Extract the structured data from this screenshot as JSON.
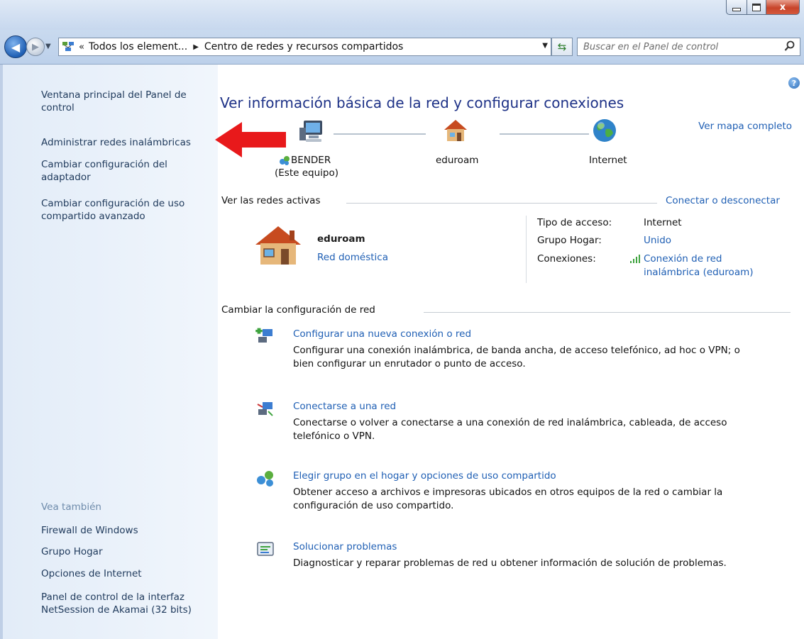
{
  "titlebar": {
    "minimize_icon": "minimize-icon",
    "maximize_icon": "maximize-icon",
    "close_icon": "close-icon",
    "close_glyph": "x"
  },
  "navbar": {
    "back_glyph": "◀",
    "forward_glyph": "▶",
    "breadcrumb": [
      "Todos los element...",
      "Centro de redes y recursos compartidos"
    ],
    "chevron_glyph": "«",
    "separator_glyph": "▶",
    "search_placeholder": "Buscar en el Panel de control"
  },
  "sidebar": {
    "items": [
      {
        "label": "Ventana principal del Panel de control"
      },
      {
        "label": "Administrar redes inalámbricas"
      },
      {
        "label": "Cambiar configuración del adaptador"
      },
      {
        "label": "Cambiar configuración de uso compartido avanzado"
      }
    ],
    "see_also_caption": "Vea también",
    "see_also": [
      {
        "label": "Firewall de Windows"
      },
      {
        "label": "Grupo Hogar"
      },
      {
        "label": "Opciones de Internet"
      },
      {
        "label": "Panel de control de la interfaz NetSession de Akamai (32 bits)"
      }
    ]
  },
  "main": {
    "help_glyph": "?",
    "title": "Ver información básica de la red y configurar conexiones",
    "full_map_link": "Ver mapa completo",
    "network_map": {
      "computer_name": "BENDER",
      "computer_sub": "(Este equipo)",
      "network_name": "eduroam",
      "internet": "Internet"
    },
    "active_networks": {
      "heading": "Ver las redes activas",
      "connect_link": "Conectar o desconectar",
      "network_name": "eduroam",
      "network_type": "Red doméstica",
      "access_type_label": "Tipo de acceso:",
      "access_type_value": "Internet",
      "homegroup_label": "Grupo Hogar:",
      "homegroup_value": "Unido",
      "connections_label": "Conexiones:",
      "connections_value_line1": "Conexión de red",
      "connections_value_line2": "inalámbrica (eduroam)"
    },
    "change_settings": {
      "heading": "Cambiar la configuración de red",
      "tasks": [
        {
          "title": "Configurar una nueva conexión o red",
          "desc_line1": "Configurar una conexión inalámbrica, de banda ancha, de acceso telefónico, ad hoc o VPN; o",
          "desc_line2": "bien configurar un enrutador o punto de acceso.",
          "icon": "new-connection-icon"
        },
        {
          "title": "Conectarse a una red",
          "desc_line1": "Conectarse o volver a conectarse a una conexión de red inalámbrica, cableada, de acceso",
          "desc_line2": "telefónico o VPN.",
          "icon": "connect-network-icon"
        },
        {
          "title": "Elegir grupo en el hogar y opciones de uso compartido",
          "desc_line1": "Obtener acceso a archivos e impresoras ubicados en otros equipos de la red o cambiar la",
          "desc_line2": "configuración de uso compartido.",
          "icon": "homegroup-icon"
        },
        {
          "title": "Solucionar problemas",
          "desc_line1": "Diagnosticar y reparar problemas de red u obtener información de solución de problemas.",
          "desc_line2": "",
          "icon": "troubleshoot-icon"
        }
      ]
    }
  },
  "colors": {
    "link": "#1f5fb4",
    "title": "#1e3287",
    "sidebar_link": "#1e395b",
    "annotation_arrow": "#e8191b"
  }
}
